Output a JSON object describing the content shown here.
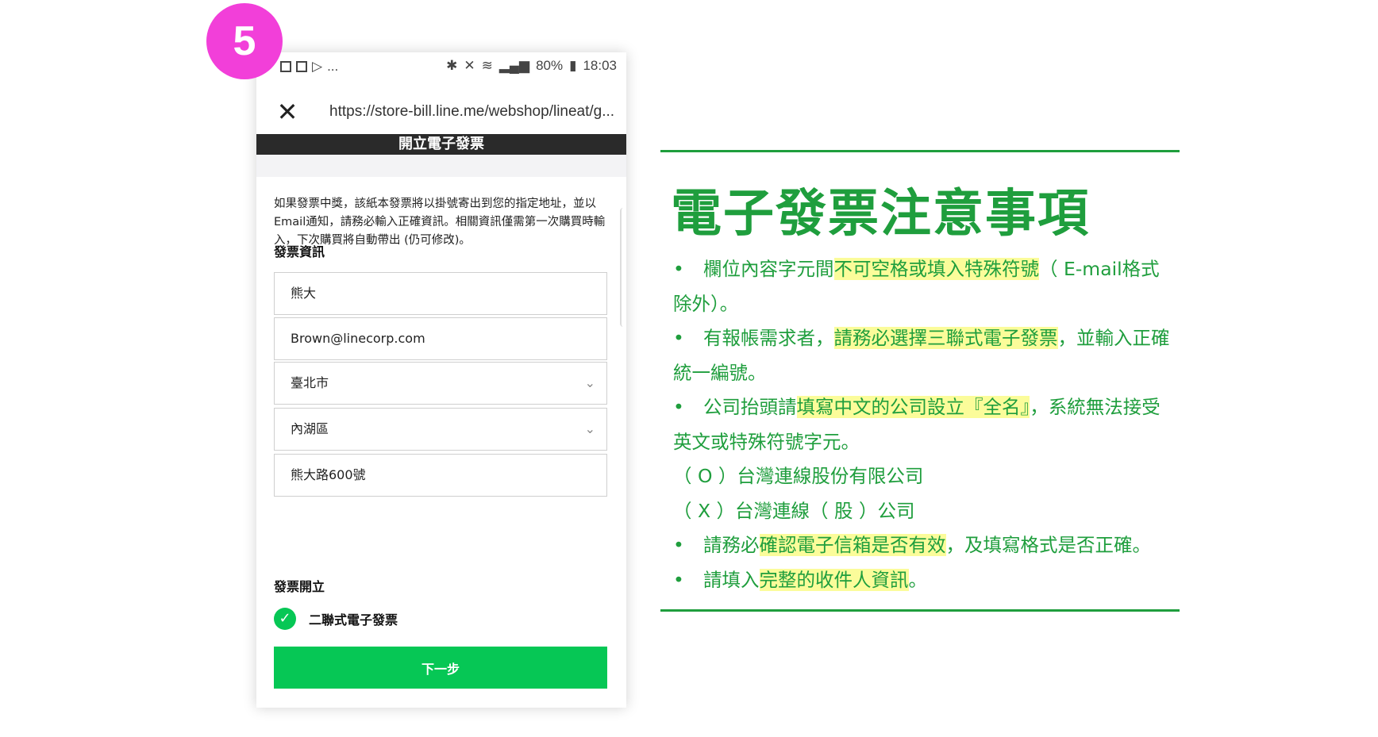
{
  "step_badge": "5",
  "phone": {
    "status": {
      "more": "...",
      "battery": "80%",
      "time": "18:03"
    },
    "url": "https://store-bill.line.me/webshop/lineat/g...",
    "header": "開立電子發票",
    "intro": "如果發票中獎，該紙本發票將以掛號寄出到您的指定地址，並以Email通知，請務必輸入正確資訊。相關資訊僅需第一次購買時輸入，下次購買將自動帶出 (仍可修改)。",
    "invoice_info_title": "發票資訊",
    "fields": {
      "name": "熊大",
      "email": "Brown@linecorp.com",
      "city": "臺北市",
      "district": "內湖區",
      "address": "熊大路600號"
    },
    "invoice_issue_title": "發票開立",
    "invoice_type": "二聯式電子發票",
    "next_button": "下一步"
  },
  "notes": {
    "title": "電子發票注意事項",
    "bullet": "•",
    "l1a": "欄位內容字元間",
    "l1b": "不可空格或填入特殊符號",
    "l1c": "（ E-mail格式",
    "l1d": "除外）。",
    "l2a": "有報帳需求者，",
    "l2b": "請務必選擇三聯式電子發票",
    "l2c": "，並輸入正確",
    "l2d": "統一編號。",
    "l3a": "公司抬頭請",
    "l3b": "填寫中文的公司設立『全名』",
    "l3c": "，系統無法接受",
    "l3d": "英文或特殊符號字元。",
    "ex_ok": "（ O ）台灣連線股份有限公司",
    "ex_ng": "（ X ）台灣連線（ 股 ）公司",
    "l4a": "請務必",
    "l4b": "確認電子信箱是否有效",
    "l4c": "，及填寫格式是否正確。",
    "l5a": "請填入",
    "l5b": "完整的收件人資訊",
    "l5c": "。"
  },
  "colors": {
    "accent_green": "#1f9e3d",
    "line_green": "#06c755",
    "highlight": "#fbfc9a",
    "badge_pink": "#f23fd9"
  }
}
